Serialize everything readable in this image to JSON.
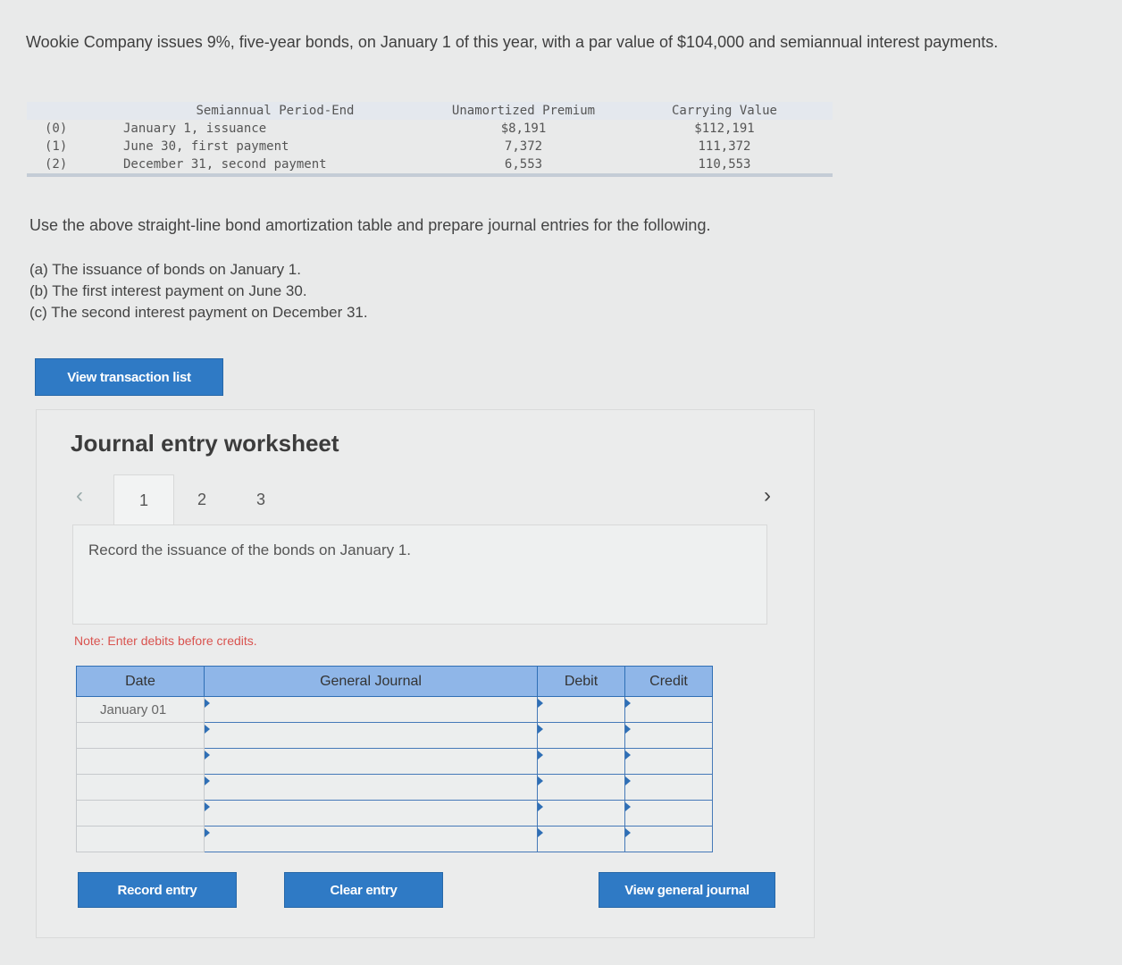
{
  "problem": {
    "intro": "Wookie Company issues 9%, five-year bonds, on January 1 of this year, with a par value of $104,000 and semiannual interest payments."
  },
  "amortization_table": {
    "headers": [
      "",
      "Semiannual Period-End",
      "Unamortized Premium",
      "Carrying Value"
    ],
    "rows": [
      {
        "index": "(0)",
        "period": "January 1, issuance",
        "premium": "$8,191",
        "carrying": "$112,191"
      },
      {
        "index": "(1)",
        "period": "June 30, first payment",
        "premium": "7,372",
        "carrying": "111,372"
      },
      {
        "index": "(2)",
        "period": "December 31, second payment",
        "premium": "6,553",
        "carrying": "110,553"
      }
    ]
  },
  "instructions": "Use the above straight-line bond amortization table and prepare journal entries for the following.",
  "parts": [
    "(a) The issuance of bonds on January 1.",
    "(b) The first interest payment on June 30.",
    "(c) The second interest payment on December 31."
  ],
  "buttons": {
    "view_transactions": "View transaction list",
    "record_entry": "Record entry",
    "clear_entry": "Clear entry",
    "view_general_journal": "View general journal"
  },
  "worksheet": {
    "title": "Journal entry worksheet",
    "tabs": [
      "1",
      "2",
      "3"
    ],
    "active_tab": "1",
    "prev_icon": "‹",
    "next_icon": "›",
    "task": "Record the issuance of the bonds on January 1.",
    "note": "Note: Enter debits before credits.",
    "columns": [
      "Date",
      "General Journal",
      "Debit",
      "Credit"
    ],
    "rows": [
      {
        "date": "January 01",
        "account": "",
        "debit": "",
        "credit": ""
      },
      {
        "date": "",
        "account": "",
        "debit": "",
        "credit": ""
      },
      {
        "date": "",
        "account": "",
        "debit": "",
        "credit": ""
      },
      {
        "date": "",
        "account": "",
        "debit": "",
        "credit": ""
      },
      {
        "date": "",
        "account": "",
        "debit": "",
        "credit": ""
      },
      {
        "date": "",
        "account": "",
        "debit": "",
        "credit": ""
      }
    ]
  }
}
